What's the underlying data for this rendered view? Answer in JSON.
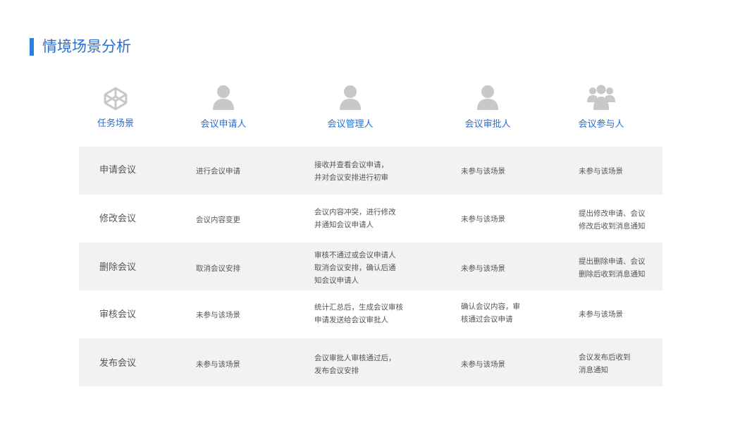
{
  "page": {
    "title": "情境场景分析",
    "accent_color": "#2a7fe0"
  },
  "columns": [
    {
      "label": "任务场景",
      "icon": "codepen-cube-icon"
    },
    {
      "label": "会议申请人",
      "icon": "user-icon"
    },
    {
      "label": "会议管理人",
      "icon": "user-icon"
    },
    {
      "label": "会议审批人",
      "icon": "user-icon"
    },
    {
      "label": "会议参与人",
      "icon": "group-icon"
    }
  ],
  "rows": [
    {
      "task": "申请会议",
      "applicant": [
        "进行会议申请"
      ],
      "manager": [
        "接收并查看会议申请，",
        "并对会议安排进行初审"
      ],
      "approver": [
        "未参与该场景"
      ],
      "participant": [
        "未参与该场景"
      ]
    },
    {
      "task": "修改会议",
      "applicant": [
        "会议内容变更"
      ],
      "manager": [
        "会议内容冲突，进行修改",
        "并通知会议申请人"
      ],
      "approver": [
        "未参与该场景"
      ],
      "participant": [
        "提出修改申请、会议",
        "修改后收到消息通知"
      ]
    },
    {
      "task": "删除会议",
      "applicant": [
        "取消会议安排"
      ],
      "manager": [
        "审核不通过或会议申请人",
        "取消会议安排，确认后通",
        "知会议申请人"
      ],
      "approver": [
        "未参与该场景"
      ],
      "participant": [
        "提出删除申请、会议",
        "删除后收到消息通知"
      ]
    },
    {
      "task": "审核会议",
      "applicant": [
        "未参与该场景"
      ],
      "manager": [
        "统计汇总后，生成会议审核",
        "申请发送给会议审批人"
      ],
      "approver": [
        "确认会议内容，审",
        "核通过会议申请"
      ],
      "participant": [
        "未参与该场景"
      ]
    },
    {
      "task": "发布会议",
      "applicant": [
        "未参与该场景"
      ],
      "manager": [
        "会议审批人审核通过后，",
        "发布会议安排"
      ],
      "approver": [
        "未参与该场景"
      ],
      "participant": [
        "会议发布后收到",
        "消息通知"
      ]
    }
  ]
}
